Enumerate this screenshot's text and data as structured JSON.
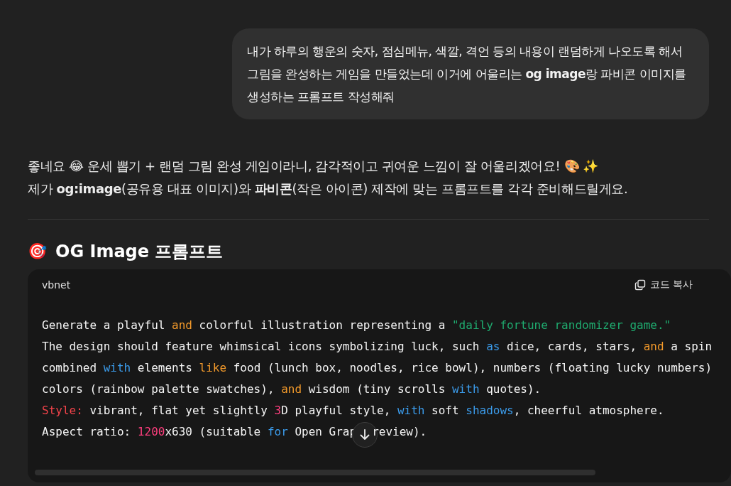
{
  "user_message": {
    "text": "내가 하루의 행운의 숫자, 점심메뉴, 색깔, 격언 등의 내용이 랜덤하게 나오도록 해서 그림을 완성하는 게임을 만들었는데 이거에 어울리는 **og image**랑 파비콘 이미지를 생성하는 프롬프트 작성해줘"
  },
  "reply": {
    "paragraphs": [
      "좋네요 😂 운세 뽑기 + 랜덤 그림 완성 게임이라니, 감각적이고 귀여운 느낌이 잘 어울리겠어요! 🎨 ✨",
      "제가 **og:image**(공유용 대표 이미지)와 **파비콘**(작은 아이콘) 제작에 맞는 프롬프트를 각각 준비해드릴게요."
    ],
    "heading": {
      "emoji": "🎯",
      "text": "OG Image 프롬프트"
    },
    "code_block": {
      "language": "vbnet",
      "copy_label": "코드 복사",
      "lines": [
        [
          {
            "kind": "plain",
            "text": "Generate a playful "
          },
          {
            "kind": "keyword",
            "text": "and"
          },
          {
            "kind": "plain",
            "text": " colorful illustration representing a "
          },
          {
            "kind": "string",
            "text": "\"daily fortune randomizer game.\""
          }
        ],
        [
          {
            "kind": "plain",
            "text": "The design should feature whimsical icons symbolizing luck, such "
          },
          {
            "kind": "builtin",
            "text": "as"
          },
          {
            "kind": "plain",
            "text": " dice, cards, stars, "
          },
          {
            "kind": "keyword",
            "text": "and"
          },
          {
            "kind": "plain",
            "text": " a spin"
          }
        ],
        [
          {
            "kind": "plain",
            "text": "combined "
          },
          {
            "kind": "builtin",
            "text": "with"
          },
          {
            "kind": "plain",
            "text": " elements "
          },
          {
            "kind": "keyword",
            "text": "like"
          },
          {
            "kind": "plain",
            "text": " food (lunch box, noodles, rice bowl), numbers (floating lucky numbers)"
          }
        ],
        [
          {
            "kind": "plain",
            "text": "colors (rainbow palette swatches), "
          },
          {
            "kind": "keyword",
            "text": "and"
          },
          {
            "kind": "plain",
            "text": " wisdom (tiny scrolls "
          },
          {
            "kind": "builtin",
            "text": "with"
          },
          {
            "kind": "plain",
            "text": " quotes)."
          }
        ],
        [
          {
            "kind": "label",
            "text": "Style:"
          },
          {
            "kind": "plain",
            "text": " vibrant, flat yet slightly "
          },
          {
            "kind": "number",
            "text": "3"
          },
          {
            "kind": "plain",
            "text": "D playful style, "
          },
          {
            "kind": "builtin",
            "text": "with"
          },
          {
            "kind": "plain",
            "text": " soft "
          },
          {
            "kind": "builtin",
            "text": "shadows"
          },
          {
            "kind": "plain",
            "text": ", cheerful atmosphere."
          }
        ],
        [
          {
            "kind": "plain",
            "text": "Aspect ratio: "
          },
          {
            "kind": "number",
            "text": "1200"
          },
          {
            "kind": "plain",
            "text": "x630 (suitable "
          },
          {
            "kind": "builtin",
            "text": "for"
          },
          {
            "kind": "plain",
            "text": " Open Grap"
          },
          {
            "kind": "covered",
            "text": "review)."
          }
        ]
      ]
    }
  }
}
